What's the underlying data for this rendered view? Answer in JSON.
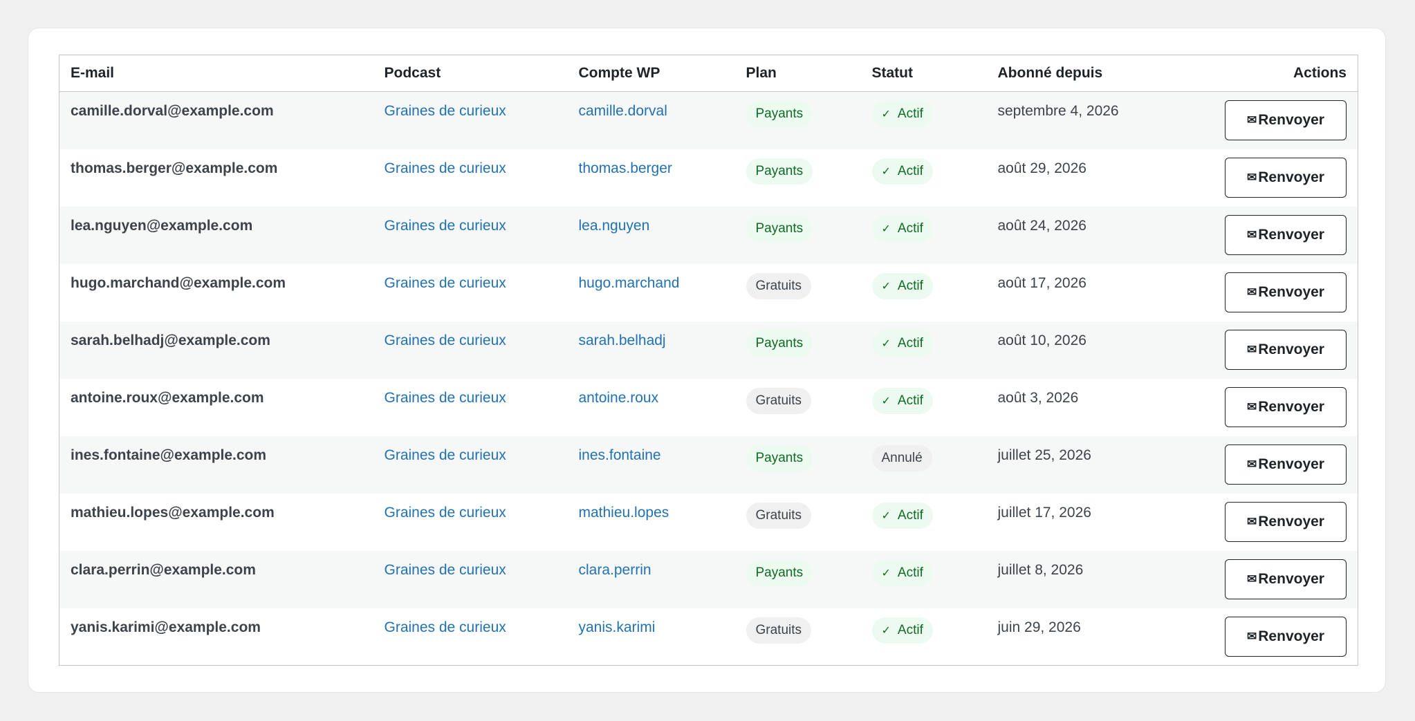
{
  "table": {
    "headers": {
      "email": "E-mail",
      "podcast": "Podcast",
      "account": "Compte WP",
      "plan": "Plan",
      "status": "Statut",
      "since": "Abonné depuis",
      "actions": "Actions"
    },
    "resend_label": "Renvoyer",
    "icons": {
      "resend": "envelope-icon",
      "active": "check-icon"
    },
    "rows": [
      {
        "email": "camille.dorval@example.com",
        "podcast": "Graines de curieux",
        "account": "camille.dorval",
        "plan": "Payants",
        "plan_type": "paid",
        "status": "Actif",
        "status_type": "active",
        "since": "septembre 4, 2026"
      },
      {
        "email": "thomas.berger@example.com",
        "podcast": "Graines de curieux",
        "account": "thomas.berger",
        "plan": "Payants",
        "plan_type": "paid",
        "status": "Actif",
        "status_type": "active",
        "since": "août 29, 2026"
      },
      {
        "email": "lea.nguyen@example.com",
        "podcast": "Graines de curieux",
        "account": "lea.nguyen",
        "plan": "Payants",
        "plan_type": "paid",
        "status": "Actif",
        "status_type": "active",
        "since": "août 24, 2026"
      },
      {
        "email": "hugo.marchand@example.com",
        "podcast": "Graines de curieux",
        "account": "hugo.marchand",
        "plan": "Gratuits",
        "plan_type": "free",
        "status": "Actif",
        "status_type": "active",
        "since": "août 17, 2026"
      },
      {
        "email": "sarah.belhadj@example.com",
        "podcast": "Graines de curieux",
        "account": "sarah.belhadj",
        "plan": "Payants",
        "plan_type": "paid",
        "status": "Actif",
        "status_type": "active",
        "since": "août 10, 2026"
      },
      {
        "email": "antoine.roux@example.com",
        "podcast": "Graines de curieux",
        "account": "antoine.roux",
        "plan": "Gratuits",
        "plan_type": "free",
        "status": "Actif",
        "status_type": "active",
        "since": "août 3, 2026"
      },
      {
        "email": "ines.fontaine@example.com",
        "podcast": "Graines de curieux",
        "account": "ines.fontaine",
        "plan": "Payants",
        "plan_type": "paid",
        "status": "Annulé",
        "status_type": "cancelled",
        "since": "juillet 25, 2026"
      },
      {
        "email": "mathieu.lopes@example.com",
        "podcast": "Graines de curieux",
        "account": "mathieu.lopes",
        "plan": "Gratuits",
        "plan_type": "free",
        "status": "Actif",
        "status_type": "active",
        "since": "juillet 17, 2026"
      },
      {
        "email": "clara.perrin@example.com",
        "podcast": "Graines de curieux",
        "account": "clara.perrin",
        "plan": "Payants",
        "plan_type": "paid",
        "status": "Actif",
        "status_type": "active",
        "since": "juillet 8, 2026"
      },
      {
        "email": "yanis.karimi@example.com",
        "podcast": "Graines de curieux",
        "account": "yanis.karimi",
        "plan": "Gratuits",
        "plan_type": "free",
        "status": "Actif",
        "status_type": "active",
        "since": "juin 29, 2026"
      }
    ]
  }
}
